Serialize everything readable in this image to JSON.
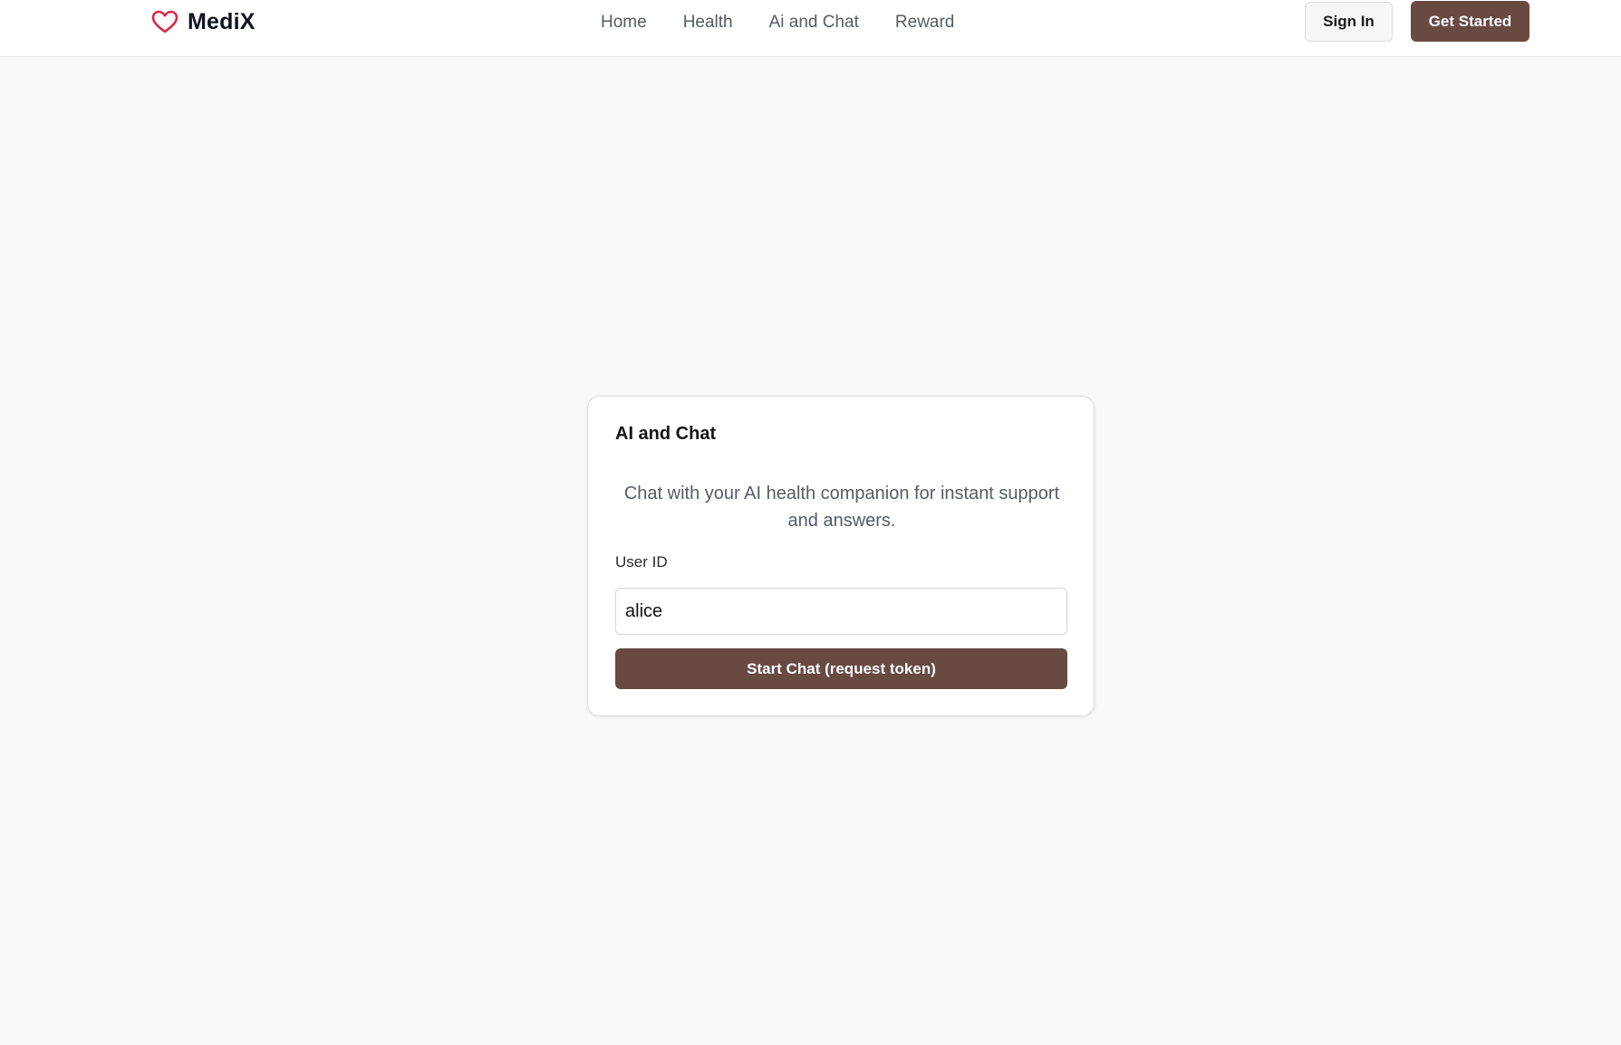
{
  "header": {
    "brand": "MediX",
    "brand_icon": "heart-icon",
    "nav": [
      {
        "label": "Home"
      },
      {
        "label": "Health"
      },
      {
        "label": "Ai and Chat"
      },
      {
        "label": "Reward"
      }
    ],
    "sign_in_label": "Sign In",
    "get_started_label": "Get Started"
  },
  "card": {
    "title": "AI and Chat",
    "description": "Chat with your AI health companion for instant support and answers.",
    "user_id_label": "User ID",
    "user_id_value": "alice",
    "start_label": "Start Chat (request token)"
  },
  "colors": {
    "accent": "#684a42",
    "heart": "#d72a4a",
    "background": "#f9f9f9"
  }
}
